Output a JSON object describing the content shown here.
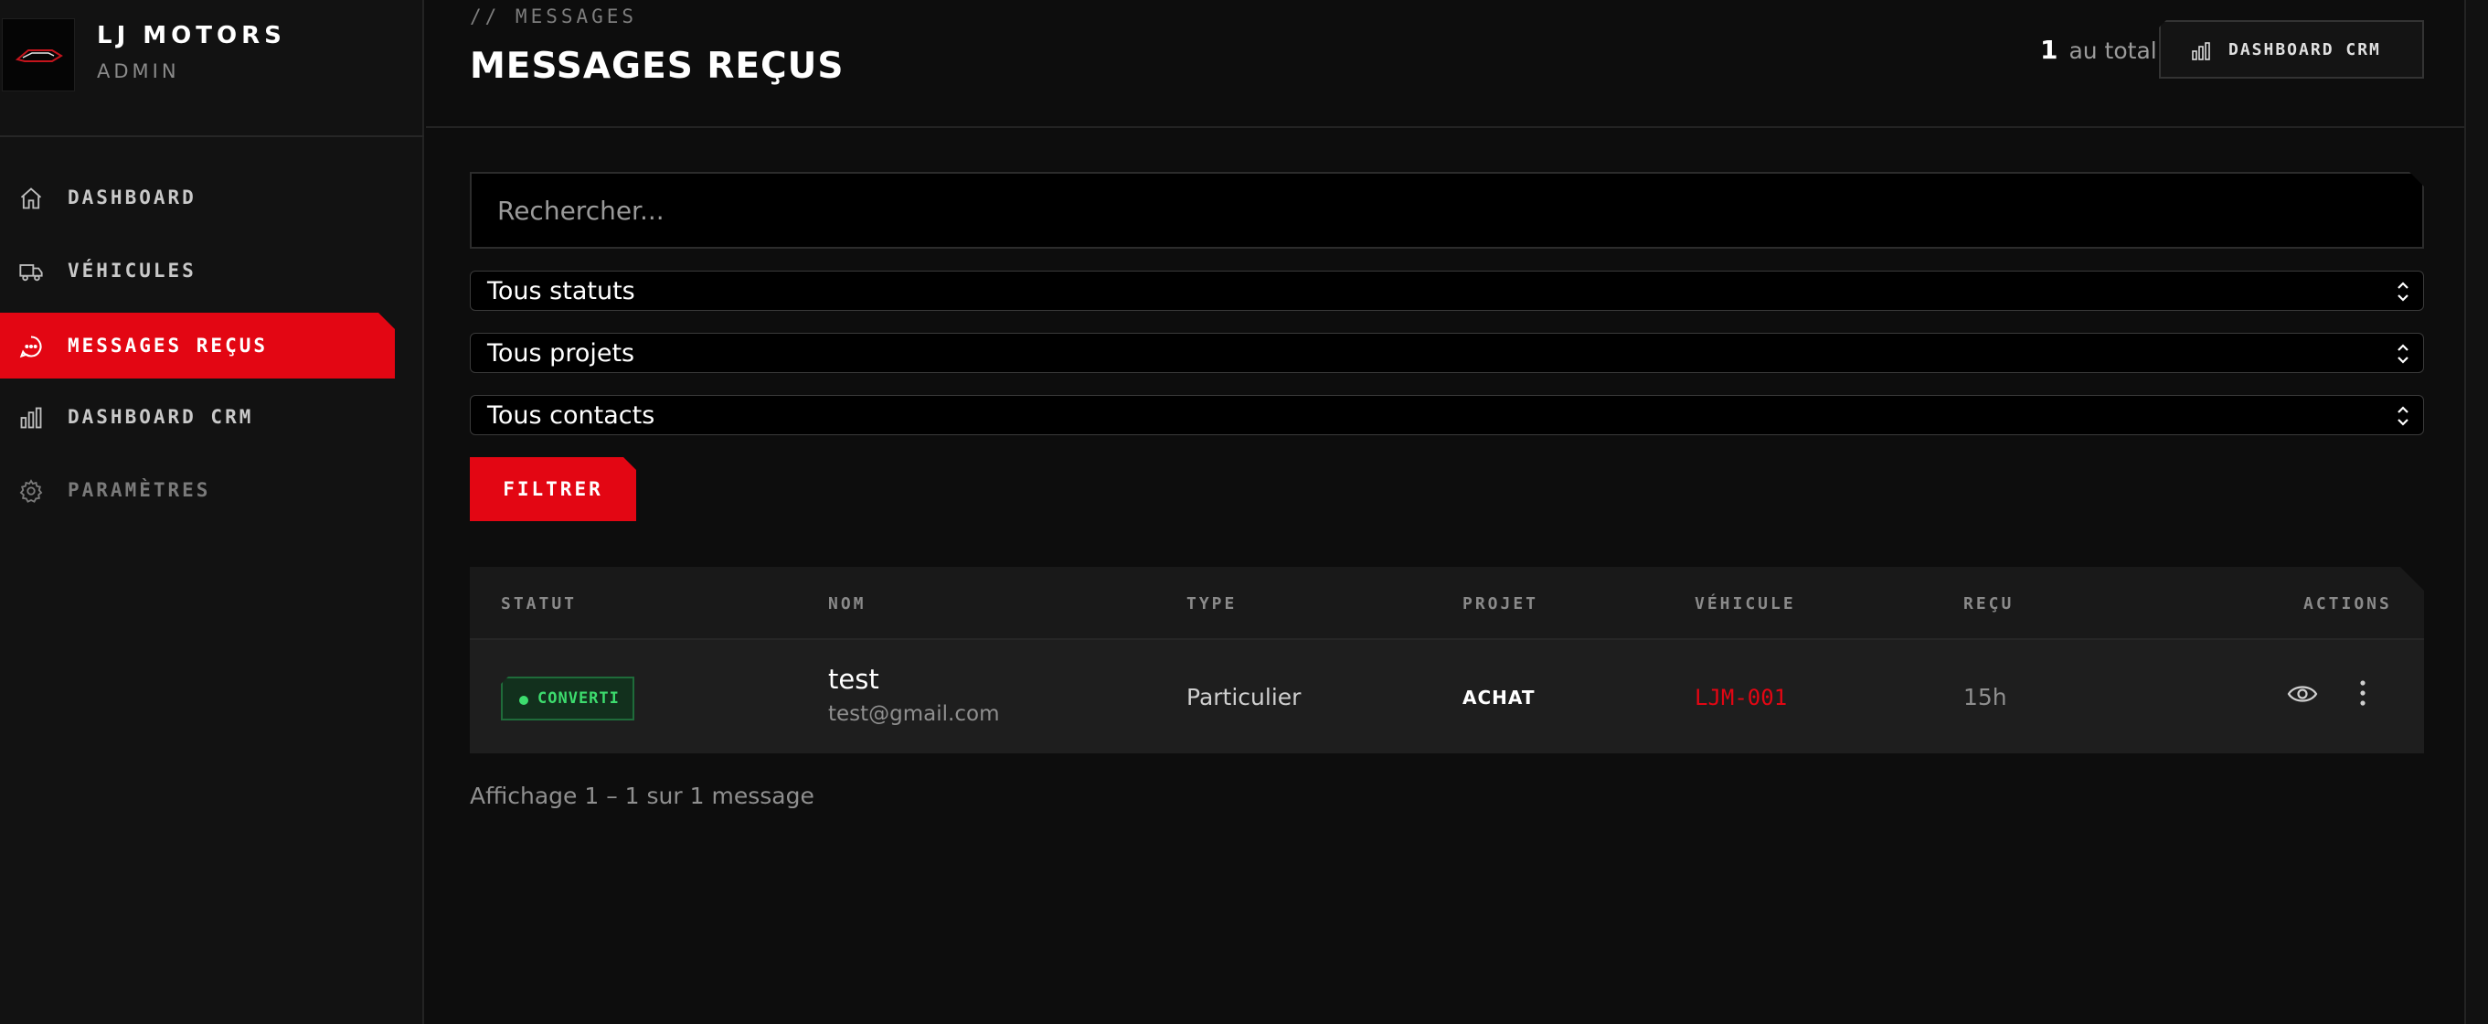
{
  "brand": {
    "name": "LJ MOTORS",
    "role": "ADMIN"
  },
  "nav": {
    "items": [
      {
        "label": "DASHBOARD",
        "icon": "home-icon"
      },
      {
        "label": "VÉHICULES",
        "icon": "truck-icon"
      },
      {
        "label": "MESSAGES REÇUS",
        "icon": "message-icon",
        "active": true
      },
      {
        "label": "DASHBOARD CRM",
        "icon": "bar-chart-icon"
      },
      {
        "label": "PARAMÈTRES",
        "icon": "gear-icon"
      }
    ]
  },
  "header": {
    "breadcrumb": "// MESSAGES",
    "title": "MESSAGES REÇUS",
    "total_count": "1",
    "total_suffix": "au total",
    "crm_button": "DASHBOARD CRM"
  },
  "filters": {
    "search_placeholder": "Rechercher...",
    "status_select": "Tous statuts",
    "project_select": "Tous projets",
    "contact_select": "Tous contacts",
    "filter_button": "FILTRER"
  },
  "table": {
    "columns": [
      "STATUT",
      "NOM",
      "TYPE",
      "PROJET",
      "VÉHICULE",
      "REÇU",
      "ACTIONS"
    ],
    "rows": [
      {
        "status": "CONVERTI",
        "name": "test",
        "email": "test@gmail.com",
        "type": "Particulier",
        "project": "ACHAT",
        "vehicle": "LJM-001",
        "received": "15h"
      }
    ]
  },
  "pagination": {
    "summary": "Affichage 1 – 1 sur 1 message"
  },
  "colors": {
    "accent": "#e30613",
    "background": "#0d0d0d",
    "status_converted": "#3ddc6e"
  }
}
